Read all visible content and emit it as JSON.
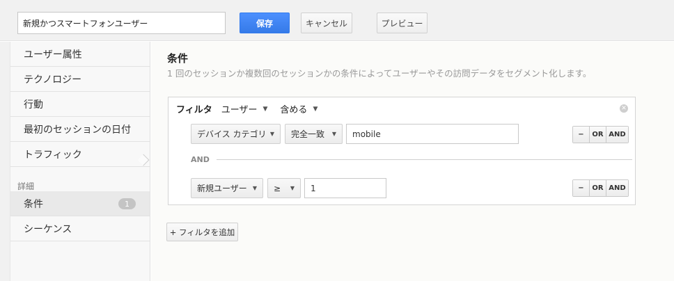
{
  "header": {
    "segment_name": "新規かつスマートフォンユーザー",
    "save_label": "保存",
    "cancel_label": "キャンセル",
    "preview_label": "プレビュー"
  },
  "sidebar": {
    "items": [
      {
        "label": "ユーザー属性"
      },
      {
        "label": "テクノロジー"
      },
      {
        "label": "行動"
      },
      {
        "label": "最初のセッションの日付"
      },
      {
        "label": "トラフィック"
      }
    ],
    "section_label": "詳細",
    "advanced": [
      {
        "label": "条件",
        "count": "1"
      },
      {
        "label": "シーケンス"
      }
    ]
  },
  "main": {
    "title": "条件",
    "description": "1 回のセッションか複数回のセッションかの条件によってユーザーやその訪問データをセグメント化します。",
    "filter": {
      "label": "フィルタ",
      "scope": "ユーザー",
      "mode": "含める",
      "and_separator": "AND",
      "conditions": [
        {
          "dimension": "デバイス カテゴリ",
          "operator": "完全一致",
          "value": "mobile"
        },
        {
          "dimension": "新規ユーザー",
          "operator": "≥",
          "value": "1"
        }
      ],
      "row_buttons": {
        "remove": "−",
        "or": "OR",
        "and": "AND"
      }
    },
    "add_filter_label": "+ フィルタを追加"
  }
}
